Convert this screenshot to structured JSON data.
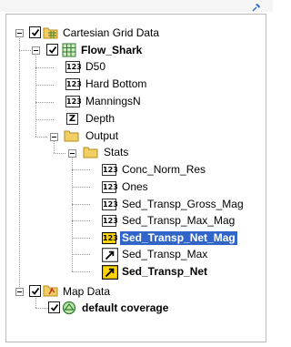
{
  "tree": {
    "nodes": {
      "cartesian_grid": {
        "label": "Cartesian Grid Data"
      },
      "flow_shark": {
        "label": "Flow_Shark"
      },
      "d50": {
        "label": "D50",
        "icon": "123"
      },
      "hard_bottom": {
        "label": "Hard Bottom",
        "icon": "123"
      },
      "mannings": {
        "label": "ManningsN",
        "icon": "123"
      },
      "depth": {
        "label": "Depth",
        "icon": "Z"
      },
      "output": {
        "label": "Output"
      },
      "stats": {
        "label": "Stats"
      },
      "conc_norm_res": {
        "label": "Conc_Norm_Res",
        "icon": "123"
      },
      "ones": {
        "label": "Ones",
        "icon": "123"
      },
      "gross_mag": {
        "label": "Sed_Transp_Gross_Mag",
        "icon": "123"
      },
      "max_mag": {
        "label": "Sed_Transp_Max_Mag",
        "icon": "123"
      },
      "net_mag": {
        "label": "Sed_Transp_Net_Mag",
        "icon": "123"
      },
      "transp_max": {
        "label": "Sed_Transp_Max"
      },
      "transp_net": {
        "label": "Sed_Transp_Net"
      },
      "map_data": {
        "label": "Map Data"
      },
      "default_coverage": {
        "label": "default coverage"
      }
    }
  },
  "colors": {
    "selection": "#3166c8",
    "folder": "#f2cf62",
    "pin": "#2f6fd1"
  }
}
